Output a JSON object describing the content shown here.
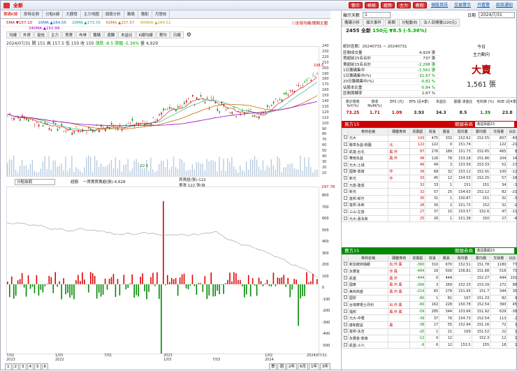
{
  "title": "全新",
  "top_buttons": [
    "警示",
    "帳務",
    "趨勢",
    "主力",
    "教程"
  ],
  "top_links": [
    "個股資訊",
    "交易警示",
    "只看警",
    "給我通知"
  ],
  "tabs1": [
    "籌碼K線",
    "即時走勢",
    "分點K線",
    "大額發",
    "主力地圖",
    "個股分析",
    "籌碼",
    "籌配",
    "月營收"
  ],
  "ma_line": [
    "5MA ▼157.10",
    "10MA ▲164.05",
    "20MA ▲173.70",
    "60MA ▲157.57",
    "400MA ▲164.51"
  ],
  "ma_line2": "240MA ▲152.99",
  "ma_right": "☐全部均線/關閉主圖",
  "tabs2": [
    "均線",
    "外資",
    "投信",
    "主力",
    "買賣",
    "布林",
    "籌碼",
    "週轉",
    "本益比",
    "K線均線",
    "賣均",
    "日線"
  ],
  "info1": {
    "date": "2024/07/31",
    "open": "開 151",
    "high": "高 157.5",
    "low": "低 150",
    "close": "收 150",
    "chg": "漲跌 -8.5",
    "pct": "漲幅 -5.36%",
    "vol": "量 4,929"
  },
  "y1": [
    "240",
    "230",
    "220",
    "210",
    "200",
    "190",
    "180",
    "170",
    "160",
    "150",
    "140",
    "130",
    "120",
    "110",
    "100",
    "90",
    "80",
    "70",
    "60",
    "50",
    "40",
    "30",
    "20",
    "10"
  ],
  "y1_high": "198.5",
  "y1_low": "52.6",
  "sel1": "分點強弱",
  "info2": "超額",
  "info2_line": "一買賣買賣超(張)-4,628",
  "info2b": [
    "買賣超(張)-122",
    "賣張 122 張/自"
  ],
  "y2": [
    "800",
    "700",
    "600",
    "500",
    "400",
    "300",
    "200",
    "100",
    "0",
    "-100",
    "-200",
    "-300",
    "-400",
    "-500"
  ],
  "y2_max": "297.78",
  "x_labels": [
    "7/02",
    "2023",
    "1/03",
    "2022",
    "7/01",
    "1/03",
    "2023",
    "7/03",
    "1/02",
    "2024",
    "2024/07/31"
  ],
  "bottombar": [
    "1",
    "2",
    "3",
    "4",
    "5",
    "6",
    "季",
    "週",
    "2年",
    "6月",
    "1年",
    "3年"
  ],
  "rp": {
    "label": "顯示天數",
    "days": "1",
    "date_lbl": "日期",
    "date": "2024/7/31",
    "tabs": [
      "籌碼分析",
      "個大事件",
      "新聞",
      "分點動向",
      "法人目標價(220元)"
    ],
    "stock": "2455 全新",
    "price": "150元",
    "chg": "▼8.5 (-5.36%)",
    "range": "統計區間：20240731 ~ 20240731",
    "summary": [
      [
        "區間成交量",
        "4,929 張"
      ],
      [
        "買超前15名合計",
        "737 張"
      ],
      [
        "賣超前15名合計",
        "-2,298 張"
      ],
      [
        "1日籌碼集中",
        "-1,561 張"
      ],
      [
        "1日籌碼集中(%)",
        "-31.67 %"
      ],
      [
        "20日籌碼集中(%)",
        "-0.82 %"
      ],
      [
        "佔股本比重",
        "-0.84 %"
      ],
      [
        "區間周轉率",
        "2.67 %"
      ]
    ],
    "big_a": "今日",
    "big_a2": "主力動向",
    "big_b": "大賣",
    "big_c": "1,561 張",
    "ratio_h": [
      "累計營收 YoY(%)",
      "營收 MoM(%)",
      "EPS (元)",
      "EPS (近4季)",
      "本益比",
      "股價 淨值比",
      "毛利率 (%)",
      "ROE (近4季)"
    ],
    "ratio_v": [
      "73.25",
      "1.71",
      "1.09",
      "3.93",
      "34.3",
      "8.5",
      "1.39",
      "23.8"
    ]
  },
  "buy": {
    "title": "買方15",
    "btn": "關鍵券商",
    "dd": "滿溢買超15",
    "cols": [
      "",
      "券商名稱",
      "關鍵券商",
      "買賣超",
      "買張",
      "賣張",
      "買均價",
      "賣均價",
      "交易量",
      "佔比"
    ],
    "rows": [
      [
        "元大",
        "",
        "143",
        "475",
        "332",
        "152.62",
        "152.55",
        "807",
        "-40"
      ],
      [
        "聯準永昌-桃園",
        "北.",
        "122",
        "122",
        "0",
        "151.74",
        "-",
        "122",
        "-21"
      ],
      [
        "凱基-台北",
        "風.作",
        "87",
        "276",
        "189",
        "151.73",
        "152.65",
        "465",
        "8"
      ],
      [
        "華南永昌",
        "風.作",
        "48",
        "126",
        "78",
        "153.28",
        "151.86",
        "204",
        "14"
      ],
      [
        "元大-土城",
        "",
        "46",
        "49",
        "3",
        "153.59",
        "153.33",
        "52",
        "-17"
      ],
      [
        "國泰-敦南",
        "作",
        "36",
        "68",
        "32",
        "153.12",
        "152.91",
        "100",
        "-12"
      ],
      [
        "新光",
        "作",
        "33",
        "45",
        "12",
        "154.53",
        "152.25",
        "57",
        "-18"
      ],
      [
        "元富-建成",
        "",
        "32",
        "33",
        "1",
        "151",
        "151",
        "34",
        "-3"
      ],
      [
        "新光",
        "",
        "32",
        "57",
        "25",
        "154.63",
        "152.12",
        "82",
        "-21"
      ],
      [
        "富邦-新竹",
        "",
        "30",
        "31",
        "1",
        "150.87",
        "151",
        "32",
        "-3"
      ],
      [
        "富邦-永和",
        "",
        "28",
        "30",
        "2",
        "151.73",
        "152",
        "32",
        "-2"
      ],
      [
        "三山-左營",
        "",
        "27",
        "37",
        "10",
        "153.57",
        "152.6",
        "47",
        "-11"
      ],
      [
        "元大-嘉永和",
        "",
        "25",
        "26",
        "1",
        "151.38",
        "150",
        "27",
        "-4"
      ]
    ]
  },
  "sell": {
    "title": "賣方15",
    "btn": "關鍵券商",
    "dd": "滿溢賣超15",
    "cols": [
      "",
      "券商名稱",
      "關鍵券商",
      "買賣超",
      "買張",
      "賣張",
      "買均價",
      "賣均價",
      "交易量",
      "佔比"
    ],
    "rows": [
      [
        "新加坡商瑞銀",
        "出.作.風",
        "-360",
        "310",
        "670",
        "152.51",
        "151.78",
        "1180",
        "77"
      ],
      [
        "永豐金",
        "作.風",
        "-484",
        "16",
        "500",
        "156.81",
        "151.68",
        "516",
        "73"
      ],
      [
        "凱基",
        "風.作",
        "-444",
        "0",
        "444",
        "-",
        "152.27",
        "444",
        "101"
      ],
      [
        "國泰",
        "風.作.風",
        "-266",
        "3",
        "269",
        "152.33",
        "153.29",
        "272",
        "88"
      ],
      [
        "美商高盛",
        "風.作.風",
        "-214",
        "65",
        "279",
        "151.95",
        "151.7",
        "344",
        "35"
      ],
      [
        "國票",
        "",
        "-80",
        "1",
        "81",
        "167",
        "151.33",
        "82",
        "9"
      ],
      [
        "台灣摩根士丹利",
        "出.作.風",
        "-66",
        "162",
        "228",
        "150.78",
        "152.54",
        "390",
        "45"
      ],
      [
        "福邦",
        "風.作.風",
        "-59",
        "285",
        "344",
        "153.66",
        "151.92",
        "629",
        "-38"
      ],
      [
        "元大-中壢",
        "",
        "-39",
        "37",
        "76",
        "154.73",
        "152.54",
        "113",
        "2"
      ],
      [
        "康和群益",
        "風",
        "-38",
        "17",
        "55",
        "152.94",
        "151.16",
        "72",
        "1"
      ],
      [
        "富邦-永吉",
        "",
        "-20",
        "1",
        "21",
        "169",
        "151.52",
        "22",
        "1"
      ],
      [
        "永豐金-敦南",
        "",
        "-12",
        "0",
        "12",
        "-",
        "152.3",
        "12",
        "1"
      ],
      [
        "凱基-斗六",
        "",
        "-6",
        "6",
        "12",
        "153.5",
        "155",
        "18",
        "1"
      ]
    ]
  }
}
